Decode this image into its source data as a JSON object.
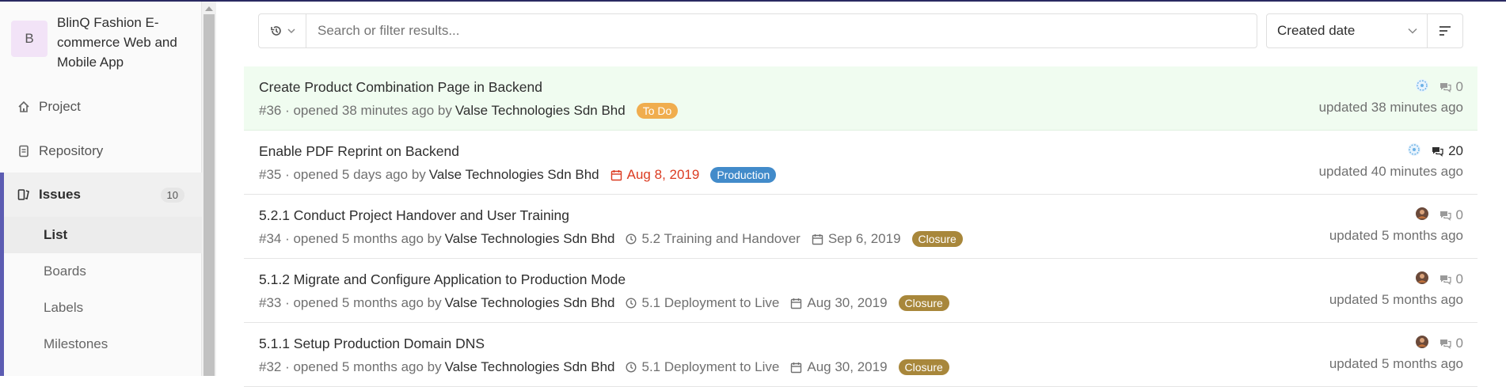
{
  "sidebar": {
    "project_avatar_letter": "B",
    "project_name": "BlinQ Fashion E-commerce Web and Mobile App",
    "nav": {
      "project": "Project",
      "repository": "Repository",
      "issues": "Issues",
      "issues_count": "10"
    },
    "sub": {
      "list": "List",
      "boards": "Boards",
      "labels": "Labels",
      "milestones": "Milestones"
    }
  },
  "filter": {
    "search_placeholder": "Search or filter results...",
    "sort_label": "Created date"
  },
  "issues": [
    {
      "title": "Create Product Combination Page in Backend",
      "ref": "#36 · opened 38 minutes ago by",
      "author": "Valse Technologies Sdn Bhd",
      "milestone": "",
      "due": "",
      "label": "To Do",
      "label_color": "#f0ad4e",
      "comments": "0",
      "updated": "updated 38 minutes ago"
    },
    {
      "title": "Enable PDF Reprint on Backend",
      "ref": "#35 · opened 5 days ago by",
      "author": "Valse Technologies Sdn Bhd",
      "milestone": "",
      "due": "Aug 8, 2019",
      "label": "Production",
      "label_color": "#428bca",
      "comments": "20",
      "updated": "updated 40 minutes ago"
    },
    {
      "title": "5.2.1 Conduct Project Handover and User Training",
      "ref": "#34 · opened 5 months ago by",
      "author": "Valse Technologies Sdn Bhd",
      "milestone": "5.2 Training and Handover",
      "due": "Sep 6, 2019",
      "label": "Closure",
      "label_color": "#a8873b",
      "comments": "0",
      "updated": "updated 5 months ago"
    },
    {
      "title": "5.1.2 Migrate and Configure Application to Production Mode",
      "ref": "#33 · opened 5 months ago by",
      "author": "Valse Technologies Sdn Bhd",
      "milestone": "5.1 Deployment to Live",
      "due": "Aug 30, 2019",
      "label": "Closure",
      "label_color": "#a8873b",
      "comments": "0",
      "updated": "updated 5 months ago"
    },
    {
      "title": "5.1.1 Setup Production Domain DNS",
      "ref": "#32 · opened 5 months ago by",
      "author": "Valse Technologies Sdn Bhd",
      "milestone": "5.1 Deployment to Live",
      "due": "Aug 30, 2019",
      "label": "Closure",
      "label_color": "#a8873b",
      "comments": "0",
      "updated": "updated 5 months ago"
    }
  ]
}
